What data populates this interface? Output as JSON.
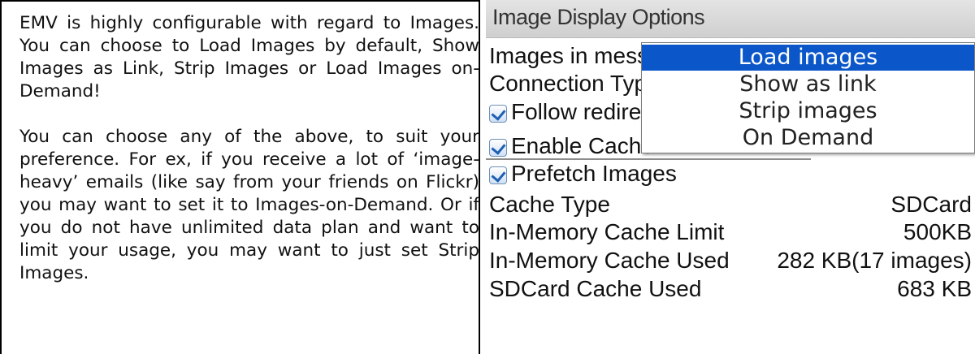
{
  "description": {
    "paragraph1": "EMV is highly configurable with regard to Images. You can choose to Load Images by default, Show Images as Link, Strip Images or Load Images on-Demand!",
    "paragraph2": "You can choose any of the above, to suit your preference. For ex, if you receive a lot of ‘image-heavy’ emails (like say from your friends on Flickr) you may want to set it to Images-on-Demand. Or if you do not have unlimited data plan and want to limit your usage, you may want to just set Strip Images."
  },
  "screen": {
    "title": "Image Display Options",
    "images_in_message_label": "Images in message",
    "connection_type_label": "Connection Type",
    "follow_redirects": {
      "label": "Follow redirects",
      "checked": true
    },
    "enable_cache": {
      "label": "Enable Cache",
      "checked": true
    },
    "prefetch_images": {
      "label": "Prefetch Images",
      "checked": true
    },
    "cache_type": {
      "label": "Cache Type",
      "value": "SDCard"
    },
    "memory_cache_limit": {
      "label": "In-Memory Cache Limit",
      "value": "500KB"
    },
    "memory_cache_used": {
      "label": "In-Memory Cache Used",
      "value": "282 KB(17 images)"
    },
    "sdcard_cache_used": {
      "label": "SDCard Cache Used",
      "value": "683 KB"
    }
  },
  "dropdown": {
    "options": [
      "Load images",
      "Show as link",
      "Strip images",
      "On Demand"
    ],
    "selected": "Load images"
  },
  "colors": {
    "selection": "#0b57c9",
    "checkbox_tick": "#1d5fb3",
    "header_bg": "#d8d8d8"
  },
  "icons": {
    "checkbox": "checkmark-checkbox-icon"
  }
}
